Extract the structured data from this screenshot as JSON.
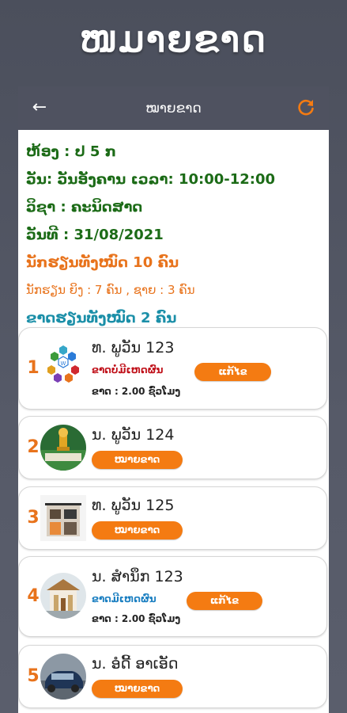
{
  "header": {
    "title": "ໜມາຍຂາດ"
  },
  "appbar": {
    "title": "ໝາຍຂາດ",
    "back_icon": "arrow-left-icon",
    "refresh_icon": "refresh-icon",
    "refresh_color": "#f47b12"
  },
  "info": {
    "classroom": "ຫ້ອງ : ປ 5 ກ",
    "day_time": "ວັນ: ວັນອັງຄານ ເວລາ: 10:00-12:00",
    "subject": "ວິຊາ : ຄະນິດສາດ",
    "date": "ວັນທີ :   31/08/2021",
    "total_students": "ນັກຮຽນທັງໝົດ 10 ຄົນ",
    "gender_breakdown": "ນັກຮຽນ ຍິງ : 7 ຄົນ , ຊາຍ : 3 ຄົນ",
    "total_absent": "ຂາດຮຽນທັງໝົດ 2 ຄົນ"
  },
  "students": [
    {
      "number": "1",
      "name": "ທ. ພູວັນ 123",
      "status": "ຂາດບໍ່ມີເຫດຜົນ",
      "price": "ຂາດ : 2.00 ຊົ່ວໂມງ",
      "button": "ແກ້ໄຂ"
    },
    {
      "number": "2",
      "name": "ນ. ພູວັນ 124",
      "button": "ໝາຍຂາດ"
    },
    {
      "number": "3",
      "name": "ທ. ພູວັນ 125",
      "button": "ໝາຍຂາດ"
    },
    {
      "number": "4",
      "name": "ນ. ສໍານຶກ 123",
      "status": "ຂາດມີເຫດຜົນ",
      "price": "ຂາດ : 2.00 ຊົ່ວໂມງ",
      "button": "ແກ້ໄຂ"
    },
    {
      "number": "5",
      "name": "ນ. ອໍດີ້ ອາເອັດ",
      "button": "ໝາຍຂາດ"
    }
  ]
}
